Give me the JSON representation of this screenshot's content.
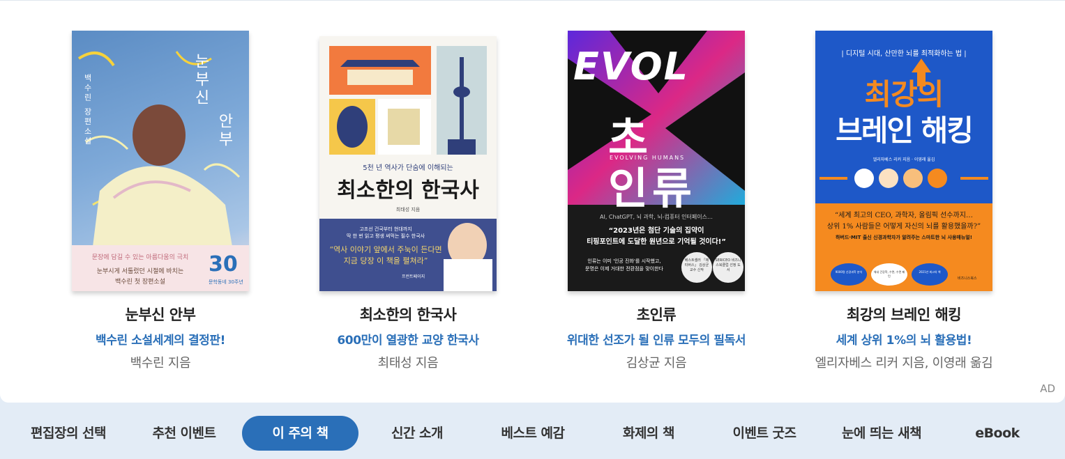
{
  "books": [
    {
      "title": "눈부신 안부",
      "tagline": "백수린 소설세계의 결정판!",
      "author": "백수린 지음",
      "cover": {
        "title_vertical_1": "눈부신",
        "title_vertical_2": "안부",
        "author_vertical": "백수린 장편소설",
        "quote": "문장에 담길 수 있는 아름다움의 극치",
        "blurb_1": "눈부시게 서툴렀던 시절에 바치는",
        "blurb_2": "백수린 첫 장편소설",
        "badge_num": "30",
        "badge_sub": "문학동네 30주년"
      }
    },
    {
      "title": "최소한의 한국사",
      "tagline": "600만이 열광한 교양 한국사",
      "author": "최태성 지음",
      "cover": {
        "kicker": "5천 년 역사가 단숨에 이해되는",
        "big_title": "최소한의 한국사",
        "author": "최태성 지음",
        "note_1": "고조선 건국부터 현대까지",
        "note_2": "딱 한 번 읽고 평생 써먹는 필수 한국사",
        "quote_1": "“역사 이야기 앞에서 주눅이 든다면",
        "quote_2": "지금 당장 이 책을 펼쳐라”",
        "publisher": "프런트페이지"
      }
    },
    {
      "title": "초인류",
      "tagline": "위대한 선조가 될 인류 모두의 필독서",
      "author": "김상균 지음",
      "cover": {
        "evol": "EVOL",
        "big_1": "초",
        "big_2": "인류",
        "subtitle": "EVOLVING HUMANS",
        "keywords": "AI, ChatGPT, 뇌 과학, 뇌-컴퓨터 인터페이스…",
        "quote_1": "“2023년은 첨단 기술의 집약이",
        "quote_2": "티핑포인트에 도달한 원년으로 기억될 것이다!”",
        "note_1": "인류는 이미 '인공 진화'를 시작했고,",
        "note_2": "문명은 이제 거대한 전환점을 맞이한다",
        "badge_1": "베스트셀러 「메타버스」 김상균 교수 신작",
        "badge_2": "SERICEO 비즈니스북클럽 선정 도서"
      }
    },
    {
      "title": "최강의 브레인 해킹",
      "tagline": "세계 상위 1%의 뇌 활용법!",
      "author": "엘리자베스 리커 지음, 이영래 옮김",
      "cover": {
        "kicker": "| 디지털 시대, 산만한 뇌를 최적화하는 법 |",
        "big_1": "최강의",
        "big_2": "브레인 해킹",
        "credits": "엘리자베스 리커 지음 · 이영래 옮김",
        "quote_1": "“세계 최고의 CEO, 과학자, 올림픽 선수까지…",
        "quote_2": "상위 1% 사람들은 어떻게 자신의 뇌를 활용했을까?”",
        "note": "하버드·MIT 출신 신경과학자가 알려주는 스마트한 뇌 사용매뉴얼!",
        "pill_1": "9000명 신경과학 분석",
        "pill_2": "체내 건강학, 수면, 수면 패턴",
        "pill_3": "2021년 최고의 책",
        "publisher": "비즈니스북스"
      }
    }
  ],
  "ad_label": "AD",
  "tabs": [
    {
      "label": "편집장의 선택",
      "active": false
    },
    {
      "label": "추천 이벤트",
      "active": false
    },
    {
      "label": "이 주의 책",
      "active": true
    },
    {
      "label": "신간 소개",
      "active": false
    },
    {
      "label": "베스트 예감",
      "active": false
    },
    {
      "label": "화제의 책",
      "active": false
    },
    {
      "label": "이벤트 굿즈",
      "active": false
    },
    {
      "label": "눈에 띄는 새책",
      "active": false
    },
    {
      "label": "eBook",
      "active": false
    }
  ],
  "colors": {
    "accent": "#2a6fb8",
    "tab_bar_bg": "#e3ecf6",
    "orange": "#f58a1f",
    "navy": "#3f4f8f"
  }
}
